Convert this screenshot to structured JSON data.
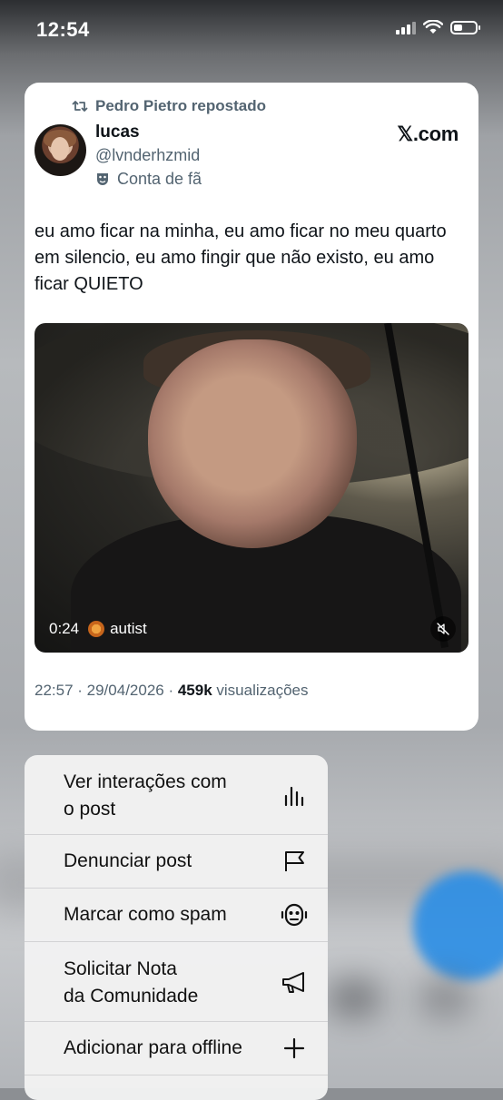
{
  "status": {
    "time": "12:54"
  },
  "tweet": {
    "repost_label": "Pedro Pietro repostado",
    "name": "lucas",
    "handle": "@lvnderhzmid",
    "badge": "Conta de fã",
    "source": "𝕏.com",
    "text": "eu amo ficar na minha, eu amo ficar no meu quarto em silencio, eu amo fingir que não existo, eu amo ficar QUIETO",
    "video": {
      "duration": "0:24",
      "caption": "autist"
    },
    "timestamp": "22:57 · 29/04/2026 · ",
    "views_count": "459k",
    "views_label": " visualizações"
  },
  "menu": {
    "items": [
      {
        "label_line1": "Ver interações com",
        "label_line2": "o post",
        "icon": "bar-chart-icon"
      },
      {
        "label": "Denunciar post",
        "icon": "flag-icon"
      },
      {
        "label": "Marcar como spam",
        "icon": "robot-icon"
      },
      {
        "label_line1": "Solicitar Nota",
        "label_line2": "da Comunidade",
        "icon": "megaphone-icon"
      },
      {
        "label": "Adicionar para offline",
        "icon": "plus-icon"
      }
    ]
  },
  "colors": {
    "accent": "#1d9bf0",
    "secondary_text": "#536471",
    "primary_text": "#0f1419"
  }
}
